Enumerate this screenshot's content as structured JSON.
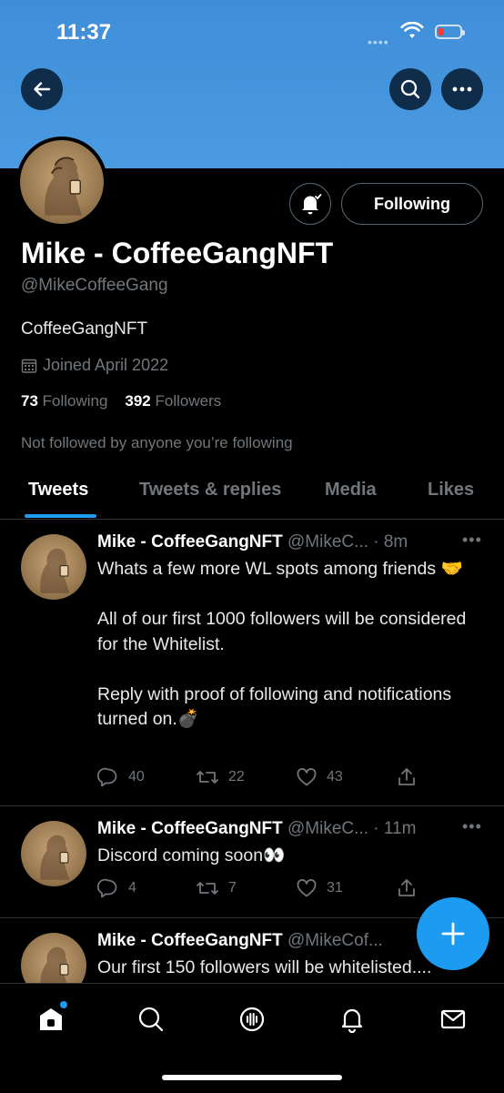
{
  "status_bar": {
    "time": "11:37"
  },
  "profile": {
    "name": "Mike - CoffeeGangNFT",
    "handle": "@MikeCoffeeGang",
    "bio": "CoffeeGangNFT",
    "joined": "Joined April 2022",
    "following_count": "73",
    "following_label": "Following",
    "followers_count": "392",
    "followers_label": "Followers",
    "not_followed_text": "Not followed by anyone you’re following",
    "follow_button_label": "Following"
  },
  "tabs": [
    "Tweets",
    "Tweets & replies",
    "Media",
    "Likes"
  ],
  "tweets": [
    {
      "name": "Mike - CoffeeGangNFT",
      "meta": "@MikeC... · 8m",
      "text": "Whats a few more WL spots among friends 🤝\n\nAll of our first 1000 followers will be considered for the Whitelist.\n\nReply with proof of following and notifications turned on.💣",
      "replies": "40",
      "retweets": "22",
      "likes": "43"
    },
    {
      "name": "Mike - CoffeeGangNFT",
      "meta": "@MikeC... · 11m",
      "text": "Discord coming soon👀",
      "replies": "4",
      "retweets": "7",
      "likes": "31"
    },
    {
      "name": "Mike - CoffeeGangNFT",
      "meta": "@MikeCof...",
      "text": "Our first 150 followers will be whitelisted...."
    }
  ],
  "icons": {
    "back": "arrow-left-icon",
    "search": "search-icon",
    "more": "more-icon",
    "bell": "bell-icon",
    "calendar": "calendar-icon",
    "reply": "reply-icon",
    "retweet": "retweet-icon",
    "like": "heart-icon",
    "share": "share-icon",
    "compose": "plus-icon",
    "nav": [
      "home-icon",
      "search-icon",
      "spaces-icon",
      "notifications-icon",
      "messages-icon"
    ]
  },
  "colors": {
    "banner": "#4a9be2",
    "accent": "#1d9bf0",
    "background": "#000000",
    "secondary_text": "#71767b"
  }
}
